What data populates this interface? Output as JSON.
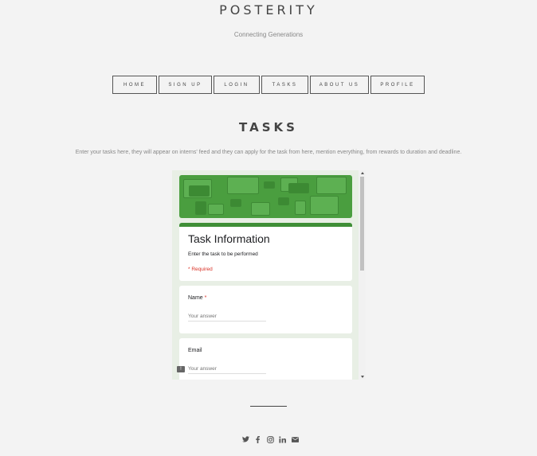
{
  "site": {
    "title": "POSTERITY",
    "tagline": "Connecting Generations"
  },
  "nav": {
    "items": [
      {
        "label": "HOME"
      },
      {
        "label": "SIGN UP"
      },
      {
        "label": "LOGIN"
      },
      {
        "label": "TASKS"
      },
      {
        "label": "ABOUT US"
      },
      {
        "label": "PROFILE"
      }
    ]
  },
  "section": {
    "title": "TASKS",
    "intro": "Enter your tasks here, they will appear on interns' feed and they can apply for the task from here, mention everything, from rewards to duration and deadline."
  },
  "form": {
    "heading": "Task Information",
    "description": "Enter the task to be performed",
    "required_note": "* Required",
    "questions": [
      {
        "label": "Name",
        "required_mark": "*",
        "placeholder": "Your answer"
      },
      {
        "label": "Email",
        "required_mark": "",
        "placeholder": "Your answer"
      }
    ],
    "feedback_icon": "!"
  },
  "footer": {
    "icons": [
      "twitter-icon",
      "facebook-icon",
      "instagram-icon",
      "linkedin-icon",
      "email-icon"
    ]
  },
  "colors": {
    "form_accent": "#3f8f37",
    "banner": "#4a9e3f",
    "required": "#d93025",
    "background": "#f3f3f3"
  }
}
